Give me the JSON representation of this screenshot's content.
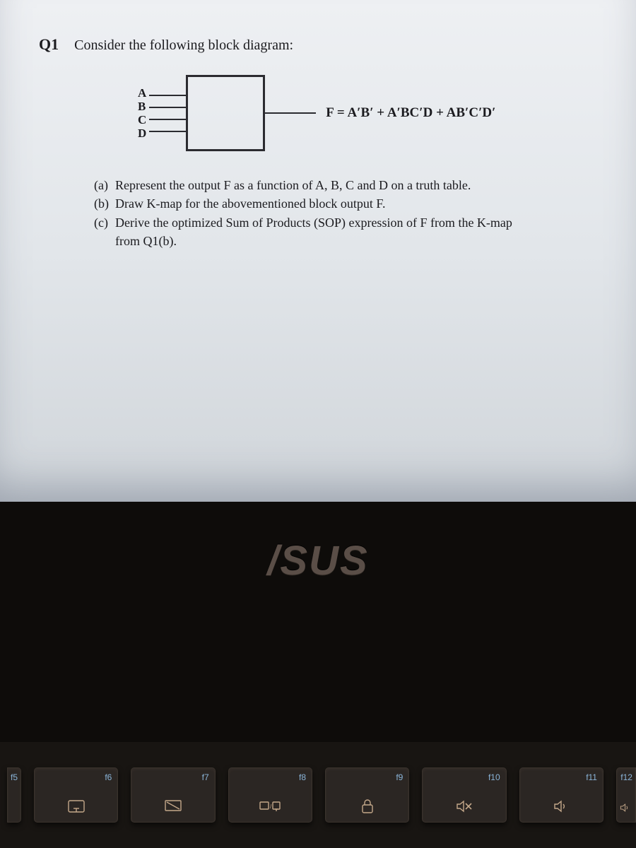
{
  "question": {
    "number": "Q1",
    "title": "Consider the following block diagram:"
  },
  "diagram": {
    "inputs": [
      "A",
      "B",
      "C",
      "D"
    ],
    "output_formula": "F = A′B′ + A′BC′D + AB′C′D′"
  },
  "parts": {
    "a": {
      "label": "(a)",
      "text": "Represent the output F as a function of A, B, C and D on a truth table."
    },
    "b": {
      "label": "(b)",
      "text": "Draw K-map for the abovementioned block output F."
    },
    "c": {
      "label": "(c)",
      "text": "Derive the optimized Sum of Products (SOP) expression of F from the K-map",
      "text2": "from Q1(b)."
    }
  },
  "brand": "/SUS",
  "keys": {
    "f5": "f5",
    "f6": "f6",
    "f7": "f7",
    "f8": "f8",
    "f9": "f9",
    "f10": "f10",
    "f11": "f11",
    "f12": "f12"
  }
}
